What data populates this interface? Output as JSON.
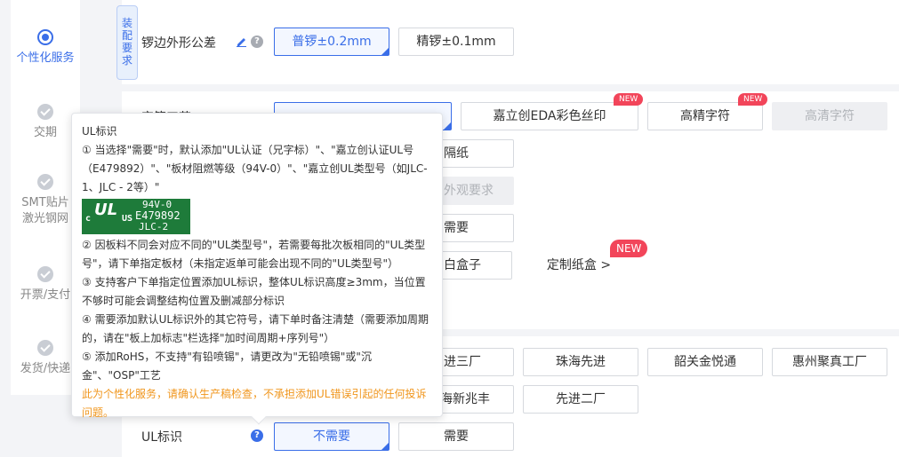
{
  "steps": [
    {
      "label": "个性化服务",
      "state": "active"
    },
    {
      "label": "交期",
      "state": "done"
    },
    {
      "label": "SMT贴片",
      "label2": "激光钢网",
      "state": "done"
    },
    {
      "label": "开票/支付",
      "state": "done"
    },
    {
      "label": "发货/快递",
      "state": "done"
    }
  ],
  "assembly": {
    "tag": [
      "装",
      "配",
      "要",
      "求"
    ],
    "label": "锣边外形公差",
    "options": [
      "普锣±0.2mm",
      "精锣±0.1mm"
    ]
  },
  "row_text": {
    "label": "字符工艺",
    "opt1": "嘉立创EDA彩色丝印",
    "opt2": "高精字符",
    "opt3": "高清字符",
    "new": "NEW",
    "partial1": "隔纸",
    "partial2": "外观要求",
    "partial3": "需要",
    "partial4": "白盒子",
    "custom_box": "定制纸盒 >",
    "new_big": "NEW"
  },
  "factory": {
    "options_row1": [
      "进三厂",
      "珠海先进",
      "韶关金悦通",
      "惠州聚真工厂"
    ],
    "options_row2": [
      "海新兆丰",
      "先进二厂"
    ]
  },
  "ul_row": {
    "label": "UL标识",
    "options": [
      "不需要",
      "需要"
    ]
  },
  "tooltip": {
    "title": "UL标识",
    "p1": "① 当选择\"需要\"时，默认添加\"UL认证（兄字标）\"、\"嘉立创认证UL号（E479892）\"、\"板材阻燃等级（94V-0）\"、\"嘉立创UL类型号（如JLC-1、JLC - 2等）\"",
    "logo": {
      "c": "c",
      "ul": "UL",
      "us": "US",
      "line1": "94V-0",
      "line2": "E479892",
      "line3": "JLC-2"
    },
    "p2": "② 因板料不同会对应不同的\"UL类型号\"，若需要每批次板相同的\"UL类型号\"，请下单指定板材（未指定返单可能会出现不同的\"UL类型号\"）",
    "p3": "③ 支持客户下单指定位置添加UL标识，整体UL标识高度≥3mm，当位置不够时可能会调整结构位置及删减部分标识",
    "p4": "④ 需要添加默认UL标识外的其它符号，请下单时备注清楚（需要添加周期的，请在\"板上加标志\"栏选择\"加时间周期+序列号\"）",
    "p5": "⑤ 添加RoHS，不支持\"有铅喷锡\"，请更改为\"无铅喷锡\"或\"沉金\"、\"OSP\"工艺",
    "warn": "此为个性化服务，请确认生产稿检查，不承担添加UL错误引起的任何投诉问题。"
  },
  "icons": {
    "help": "?",
    "edit": "pencil-icon"
  },
  "colors": {
    "accent": "#3a6ee8",
    "warn": "#f0961d",
    "new_badge": "#f2455a",
    "ul_green": "#1e7b3a"
  }
}
